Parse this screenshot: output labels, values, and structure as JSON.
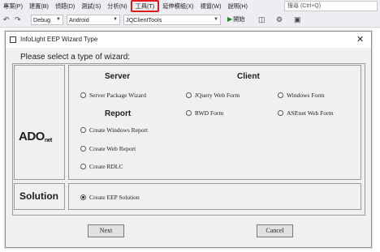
{
  "menubar": {
    "items": [
      "專案(P)",
      "建置(B)",
      "偵錯(D)",
      "測試(S)",
      "分析(N)",
      "工具(T)",
      "延伸模組(X)",
      "視窗(W)",
      "說明(H)"
    ],
    "search_placeholder": "搜尋 (Ctrl+Q)"
  },
  "toolbar": {
    "config": "Debug",
    "platform": "Android",
    "project": "JQClientTools",
    "start_label": "開始"
  },
  "dialog": {
    "title": "InfoLight EEP Wizard Type",
    "prompt": "Please select a type of wizard:",
    "ado_label": "ADO",
    "ado_sub": "net",
    "solution_label": "Solution",
    "groups": {
      "server": "Server",
      "client": "Client",
      "report": "Report"
    },
    "options": {
      "server_package": "Server Package Wizard",
      "jquery_web_form": "JQuery Web Form",
      "windows_form": "Windows Form",
      "rwd_form": "RWD Form",
      "aspnet_web_form": "ASP.net Web Form",
      "create_windows_report": "Create Windows Report",
      "create_web_report": "Create Web Report",
      "create_rdlc": "Create RDLC",
      "create_eep_solution": "Create EEP Solution"
    },
    "selected_option": "create_eep_solution",
    "next_label": "Next",
    "cancel_label": "Cancel"
  },
  "colors": {
    "highlight_box": "#e01a1a",
    "start_arrow": "#1c8a1c"
  }
}
